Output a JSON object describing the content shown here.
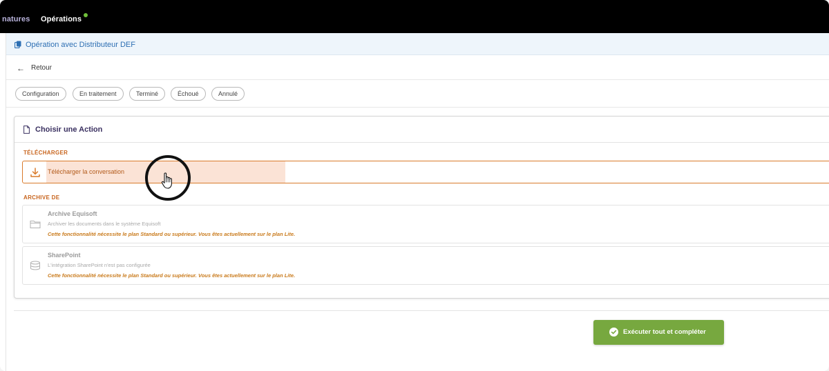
{
  "topnav": {
    "partial_item": "natures",
    "active_item": "Opérations"
  },
  "titlebar": {
    "title": "Opération avec Distributeur DEF"
  },
  "back": {
    "label": "Retour"
  },
  "status_tabs": [
    {
      "label": "Configuration"
    },
    {
      "label": "En traitement"
    },
    {
      "label": "Terminé"
    },
    {
      "label": "Échoué"
    },
    {
      "label": "Annulé"
    }
  ],
  "card": {
    "title": "Choisir une Action",
    "download_section": "TÉLÉCHARGER",
    "download_option": "Télécharger la conversation",
    "archive_section": "ARCHIVE DE",
    "archive_options": [
      {
        "title": "Archive Equisoft",
        "subtitle": "Archiver les documents dans le système Equisoft",
        "warning": "Cette fonctionnalité nécessite le plan Standard ou supérieur. Vous êtes actuellement sur le plan Lite.",
        "icon": "folder-icon"
      },
      {
        "title": "SharePoint",
        "subtitle": "L'intégration SharePoint n'est pas configurée",
        "warning": "Cette fonctionnalité nécessite le plan Standard ou supérieur. Vous êtes actuellement sur le plan Lite.",
        "icon": "database-icon"
      }
    ]
  },
  "actions": {
    "execute_label": "Exécuter tout et compléter"
  },
  "colors": {
    "accent_orange": "#d97a2a",
    "execute_green": "#77a83f",
    "title_blue": "#2d6fb3",
    "nav_status_dot": "#6fbf3a"
  }
}
